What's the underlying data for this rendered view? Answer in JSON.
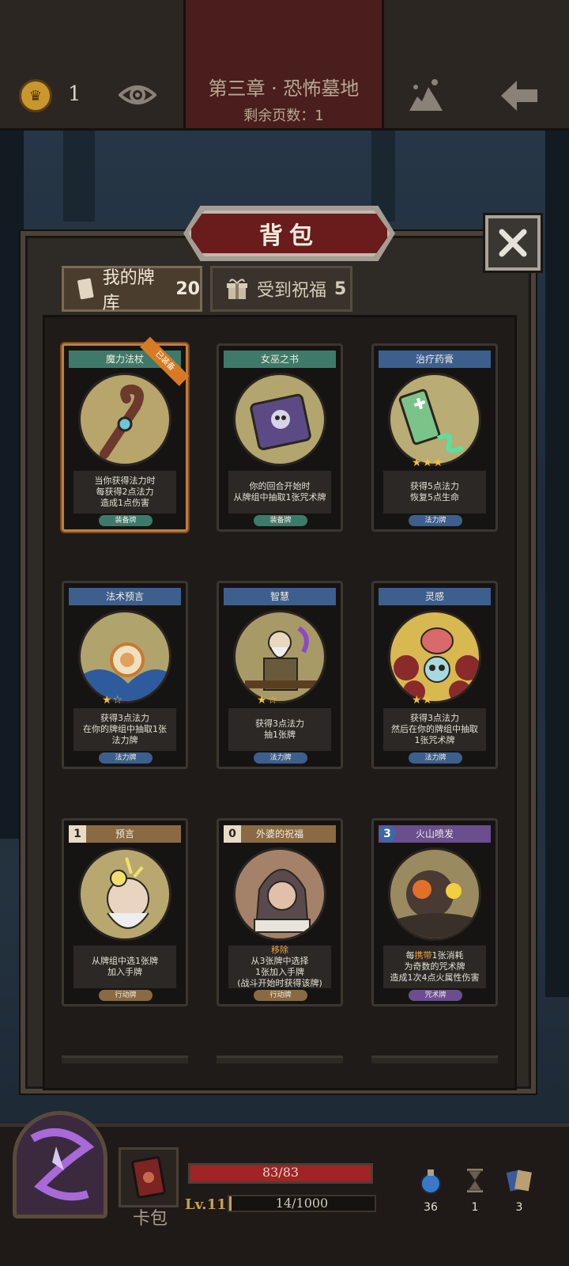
{
  "header": {
    "gold_count": "1",
    "chapter_title": "第三章 · 恐怖墓地",
    "pages_remaining": "剩余页数：1"
  },
  "panel": {
    "title": "背包",
    "tabs": [
      {
        "label": "我的牌库",
        "count": "20"
      },
      {
        "label": "受到祝福",
        "count": "5"
      }
    ]
  },
  "cards": [
    {
      "name": "魔力法杖",
      "badge": "已装备",
      "desc": [
        "当你获得法力时",
        "每获得2点法力",
        "造成1点伤害"
      ],
      "type": "装备牌",
      "stars": ""
    },
    {
      "name": "女巫之书",
      "desc": [
        "你的回合开始时",
        "从牌组中抽取1张咒术牌"
      ],
      "type": "装备牌",
      "stars": ""
    },
    {
      "name": "治疗药膏",
      "desc": [
        "获得5点法力",
        "恢复5点生命"
      ],
      "type": "法力牌",
      "stars": "★★★"
    },
    {
      "name": "法术预言",
      "desc": [
        "获得3点法力",
        "在你的牌组中抽取1张",
        "法力牌"
      ],
      "type": "法力牌",
      "stars": "★☆"
    },
    {
      "name": "智慧",
      "desc": [
        "获得3点法力",
        "抽1张牌"
      ],
      "type": "法力牌",
      "stars": "★☆"
    },
    {
      "name": "灵感",
      "desc": [
        "获得3点法力",
        "然后在你的牌组中抽取",
        "1张咒术牌"
      ],
      "type": "法力牌",
      "stars": "★★"
    },
    {
      "name": "预言",
      "cost": "1",
      "desc": [
        "从牌组中选1张牌",
        "加入手牌"
      ],
      "type": "行动牌",
      "stars": ""
    },
    {
      "name": "外婆的祝福",
      "cost": "0",
      "keyword": "移除",
      "desc": [
        "从3张牌中选择",
        "1张加入手牌",
        "(战斗开始时获得该牌)"
      ],
      "type": "行动牌",
      "stars": ""
    },
    {
      "name": "火山喷发",
      "cost": "3",
      "desc_parts": [
        "每",
        "携带",
        "1张消耗"
      ],
      "desc": [
        "为奇数的咒术牌",
        "造成1次4点火属性伤害"
      ],
      "type": "咒术牌",
      "stars": ""
    }
  ],
  "bottom": {
    "deck_label": "卡包",
    "hp_text": "83/83",
    "hp_fraction": 1.0,
    "level": "Lv.11",
    "xp_text": "14/1000",
    "xp_fraction": 0.014,
    "resources": [
      {
        "icon": "potion-icon",
        "value": "36"
      },
      {
        "icon": "hourglass-icon",
        "value": "1"
      },
      {
        "icon": "cards-icon",
        "value": "3"
      }
    ]
  },
  "colors": {
    "title_banner": "#6a1b1b",
    "equip_card": "#3e7a6a",
    "mana_card": "#3c5f8e",
    "action_card": "#8a6a42",
    "spell_card": "#6a4e8e",
    "highlight": "#f0a040"
  }
}
